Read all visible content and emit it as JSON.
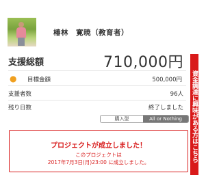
{
  "owner": {
    "name": "椿林　寛暁（教育者）"
  },
  "support": {
    "label": "支援総額",
    "value": "710,000円"
  },
  "target": {
    "icon": "target-coin-icon",
    "label": "目標金額",
    "value": "500,000円"
  },
  "supporters": {
    "label": "支援者数",
    "value": "96人"
  },
  "days_left": {
    "label": "残り日数",
    "value": "終了しました"
  },
  "funding_type": {
    "options": [
      "購入型",
      "All or Nothing"
    ],
    "selected": "All or Nothing"
  },
  "success": {
    "title": "プロジェクトが成立しました！",
    "line1": "このプロジェクトは",
    "line2": "2017年7月3日(月)23:00 に成立しました。"
  },
  "side_banner": {
    "text": "資金調達に興味がある方はこちら"
  },
  "colors": {
    "accent_red": "#d81c1c",
    "icon_orange": "#f0a020"
  }
}
